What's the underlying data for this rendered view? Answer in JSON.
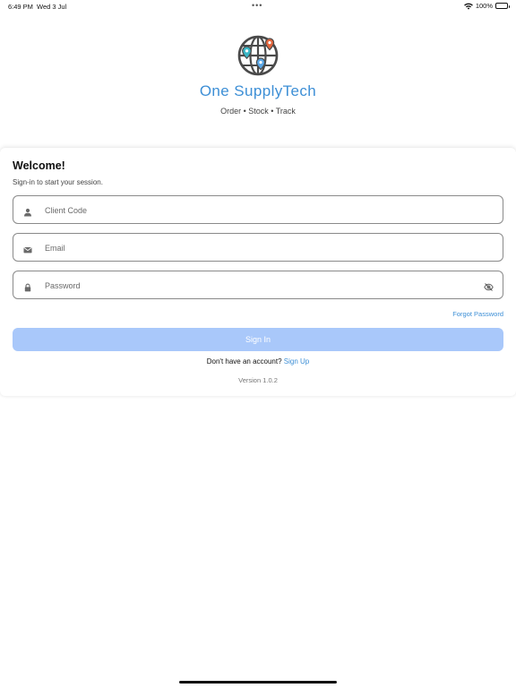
{
  "status_bar": {
    "time": "6:49 PM",
    "date": "Wed 3 Jul",
    "dots": "•••",
    "battery_percent": "100%",
    "battery_level": 1.0
  },
  "brand": {
    "name": "One SupplyTech",
    "tagline": "Order • Stock • Track",
    "icon": "globe-pins-icon",
    "color": "#3d8fd6"
  },
  "login": {
    "title": "Welcome!",
    "subtitle": "Sign-in to start your session.",
    "client_code": {
      "placeholder": "Client Code",
      "value": "",
      "icon": "user-icon"
    },
    "email": {
      "placeholder": "Email",
      "value": "",
      "icon": "mail-icon"
    },
    "password": {
      "placeholder": "Password",
      "value": "",
      "icon": "lock-icon",
      "toggle_icon": "eye-off-icon"
    },
    "forgot_password": "Forgot Password",
    "sign_in_label": "Sign In",
    "sign_in_color": "#a9c8fa",
    "no_account_text": "Don't have an account?",
    "sign_up_label": "Sign Up",
    "version": "Version 1.0.2"
  }
}
